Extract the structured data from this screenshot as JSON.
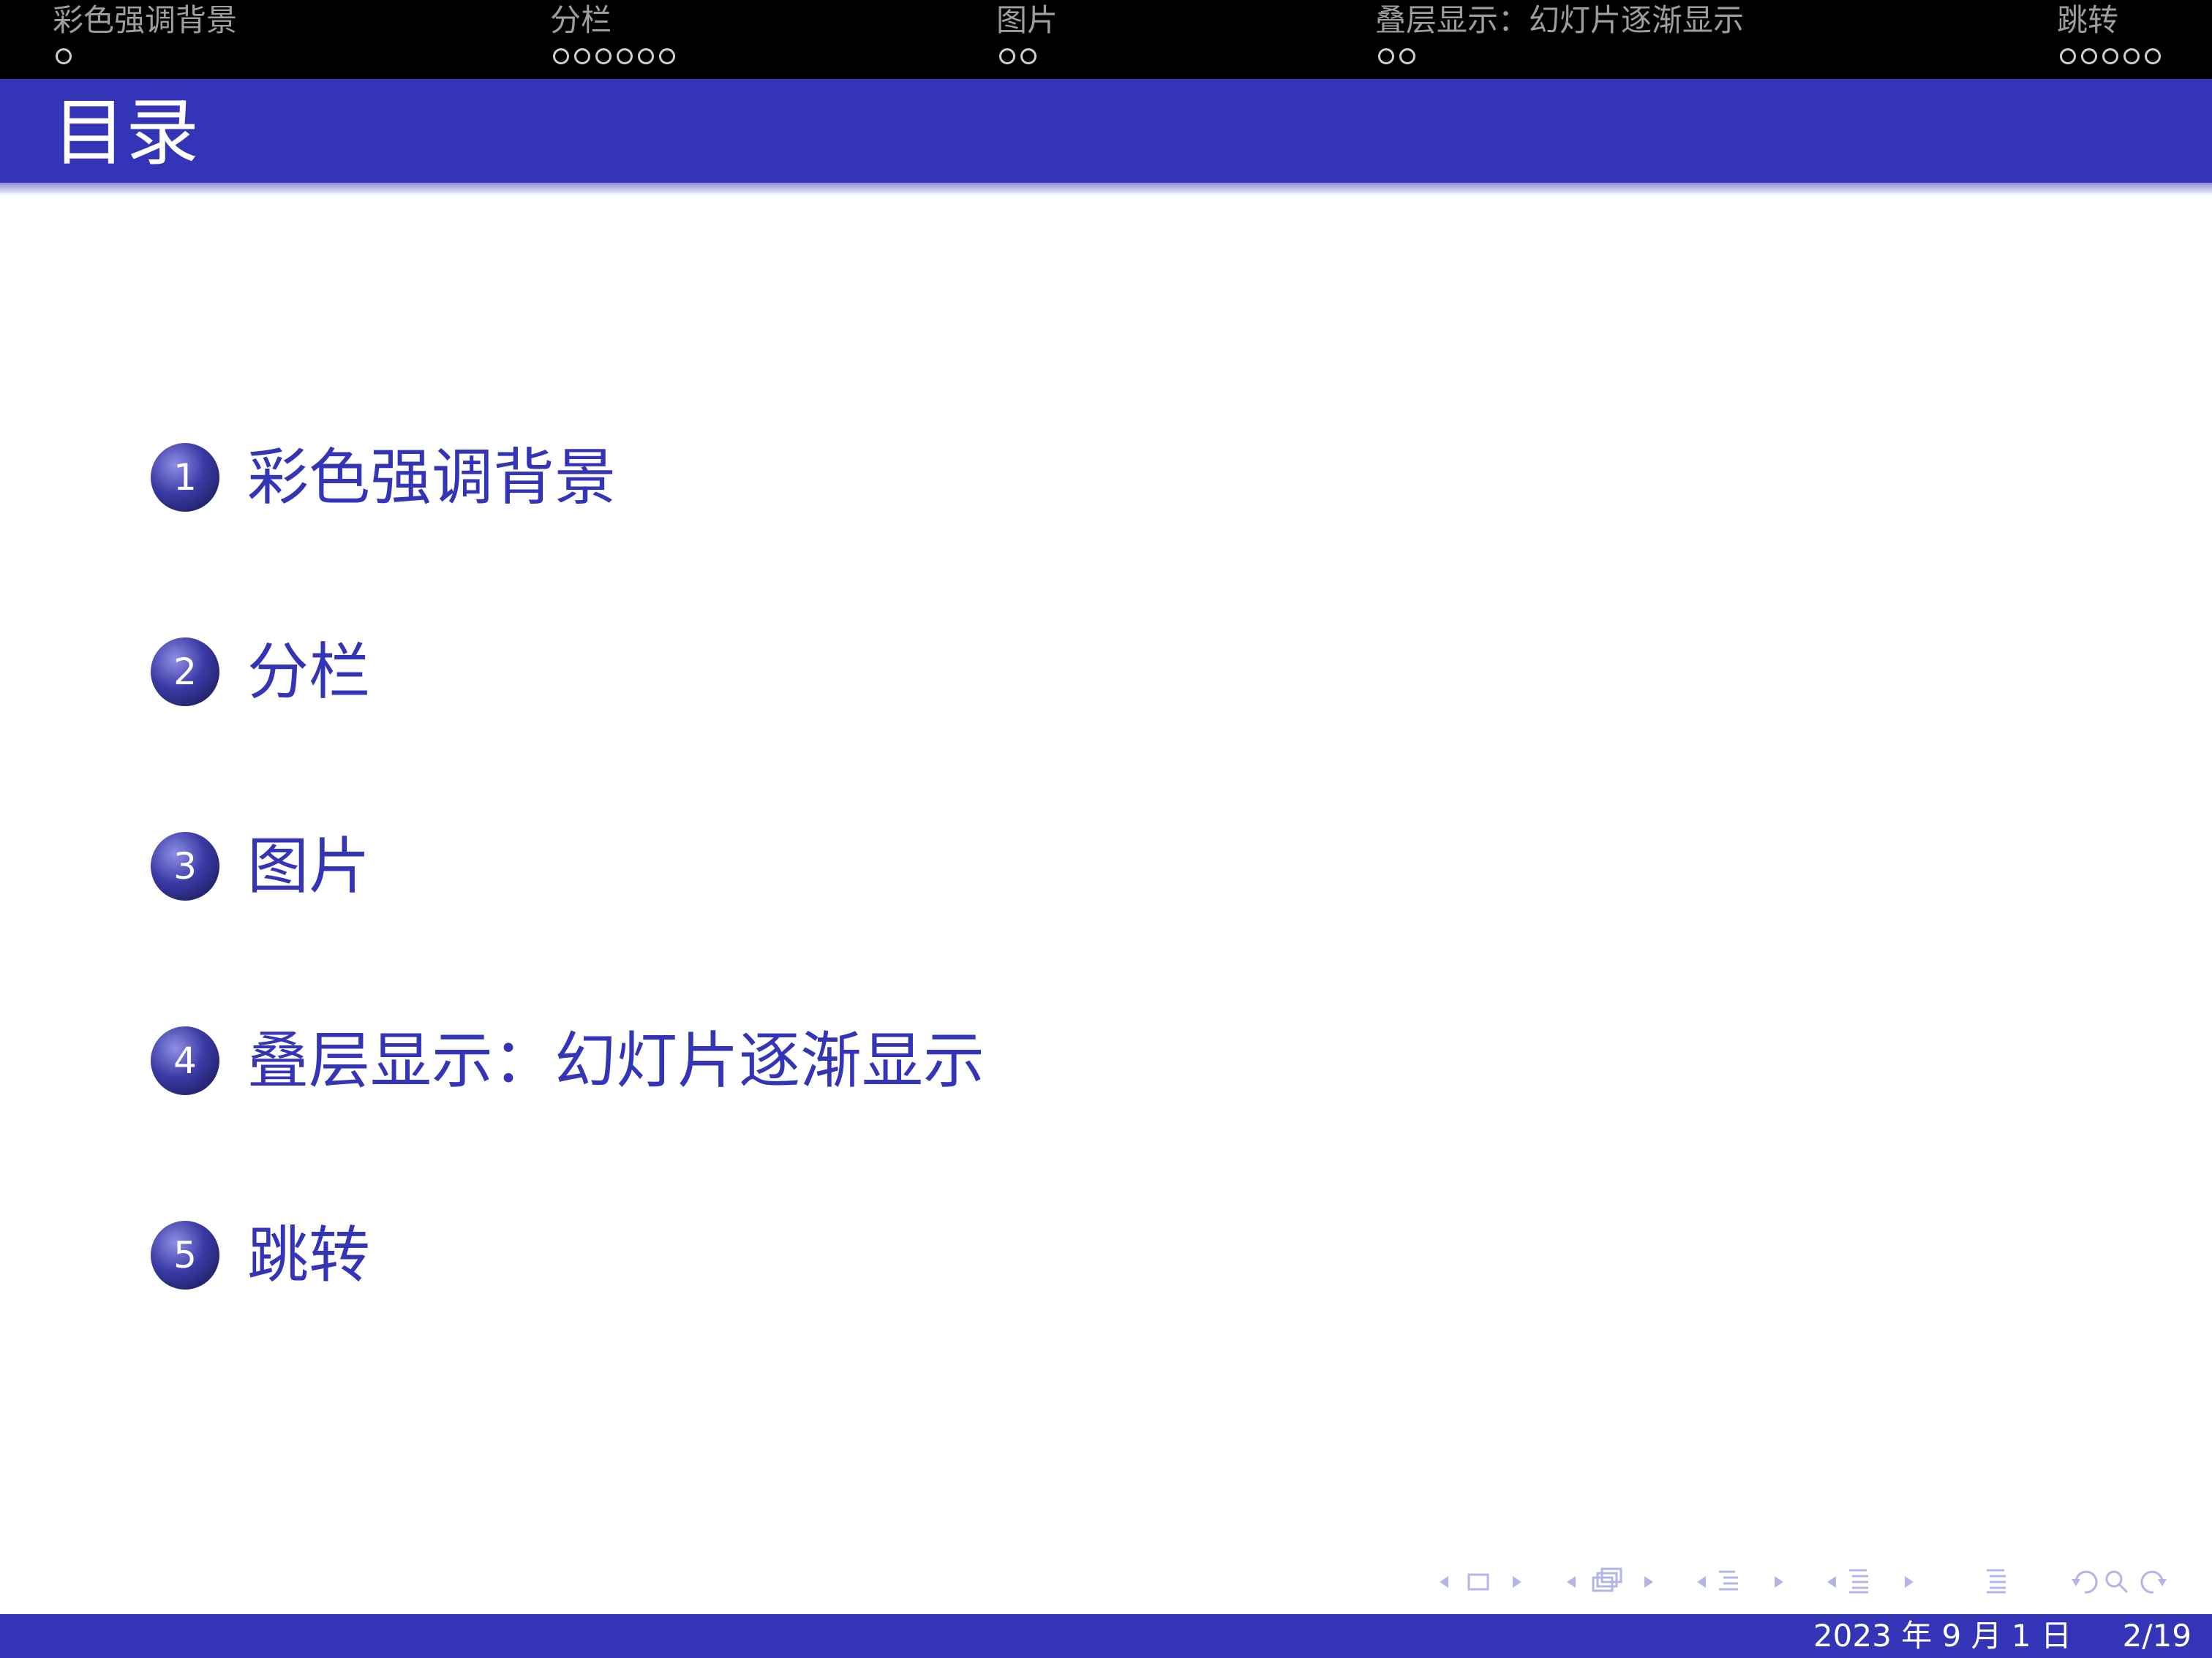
{
  "nav": {
    "sections": [
      {
        "title": "彩色强调背景",
        "dots": 1
      },
      {
        "title": "分栏",
        "dots": 6
      },
      {
        "title": "图片",
        "dots": 2
      },
      {
        "title": "叠层显示：幻灯片逐渐显示",
        "dots": 2
      },
      {
        "title": "跳转",
        "dots": 5
      }
    ]
  },
  "frame": {
    "title": "目录"
  },
  "toc": {
    "items": [
      {
        "number": "1",
        "label": "彩色强调背景"
      },
      {
        "number": "2",
        "label": "分栏"
      },
      {
        "number": "3",
        "label": "图片"
      },
      {
        "number": "4",
        "label": "叠层显示：幻灯片逐渐显示"
      },
      {
        "number": "5",
        "label": "跳转"
      }
    ]
  },
  "footer": {
    "date": "2023 年 9 月 1 日",
    "page": "2/19"
  },
  "colors": {
    "accent": "#3434b6",
    "bar": "#000000",
    "nav_text": "#9e9e9e"
  }
}
